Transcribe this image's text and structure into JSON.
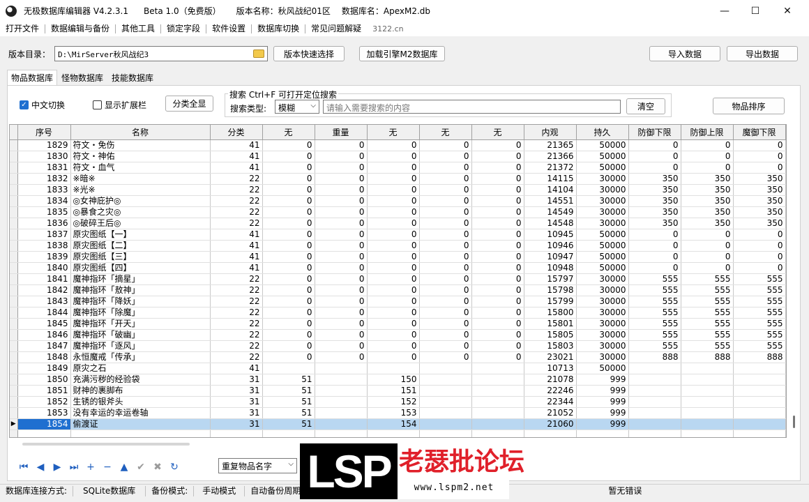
{
  "window": {
    "title_app": "无极数据库编辑器 V4.2.3.1",
    "title_edition": "Beta 1.0（免费版）",
    "title_version": "版本名称：秋风战纪01区",
    "title_db": "数据库名：ApexM2.db",
    "minimize_glyph": "—",
    "maximize_glyph": "☐",
    "close_glyph": "✕"
  },
  "menu": {
    "items": [
      "打开文件",
      "数据编辑与备份",
      "其他工具",
      "锁定字段",
      "软件设置",
      "数据库切换",
      "常见问题解疑"
    ],
    "url": "3122.cn"
  },
  "toolbar": {
    "version_dir_label": "版本目录：",
    "version_dir_value": "D:\\MirServer秋风战纪3",
    "quick_select": "版本快速选择",
    "load_engine": "加载引擎M2数据库",
    "import": "导入数据",
    "export": "导出数据"
  },
  "tabs": [
    "物品数据库",
    "怪物数据库",
    "技能数据库"
  ],
  "options": {
    "chinese_toggle": "中文切换",
    "chinese_toggle_checked": true,
    "show_ext": "显示扩展栏",
    "show_ext_checked": false,
    "show_all": "分类全显",
    "search_title": "搜索   Ctrl+F 可打开定位搜索",
    "search_type_label": "搜索类型:",
    "search_type_value": "模糊",
    "search_placeholder": "请输入需要搜索的内容",
    "clear": "清空",
    "sort": "物品排序"
  },
  "grid": {
    "columns": [
      "序号",
      "名称",
      "分类",
      "无",
      "重量",
      "无",
      "无",
      "无",
      "内观",
      "持久",
      "防御下限",
      "防御上限",
      "魔御下限"
    ],
    "rows": [
      [
        "1829",
        "符文・免伤",
        "41",
        "0",
        "0",
        "0",
        "0",
        "0",
        "21365",
        "50000",
        "0",
        "0",
        "0"
      ],
      [
        "1830",
        "符文・神佑",
        "41",
        "0",
        "0",
        "0",
        "0",
        "0",
        "21366",
        "50000",
        "0",
        "0",
        "0"
      ],
      [
        "1831",
        "符文・血气",
        "41",
        "0",
        "0",
        "0",
        "0",
        "0",
        "21372",
        "50000",
        "0",
        "0",
        "0"
      ],
      [
        "1832",
        "※暗※",
        "22",
        "0",
        "0",
        "0",
        "0",
        "0",
        "14115",
        "30000",
        "350",
        "350",
        "350"
      ],
      [
        "1833",
        "※光※",
        "22",
        "0",
        "0",
        "0",
        "0",
        "0",
        "14104",
        "30000",
        "350",
        "350",
        "350"
      ],
      [
        "1834",
        "◎女神庇护◎",
        "22",
        "0",
        "0",
        "0",
        "0",
        "0",
        "14551",
        "30000",
        "350",
        "350",
        "350"
      ],
      [
        "1835",
        "◎暴食之灾◎",
        "22",
        "0",
        "0",
        "0",
        "0",
        "0",
        "14549",
        "30000",
        "350",
        "350",
        "350"
      ],
      [
        "1836",
        "◎破碎王后◎",
        "22",
        "0",
        "0",
        "0",
        "0",
        "0",
        "14548",
        "30000",
        "350",
        "350",
        "350"
      ],
      [
        "1837",
        "原灾图纸【一】",
        "41",
        "0",
        "0",
        "0",
        "0",
        "0",
        "10945",
        "50000",
        "0",
        "0",
        "0"
      ],
      [
        "1838",
        "原灾图纸【二】",
        "41",
        "0",
        "0",
        "0",
        "0",
        "0",
        "10946",
        "50000",
        "0",
        "0",
        "0"
      ],
      [
        "1839",
        "原灾图纸【三】",
        "41",
        "0",
        "0",
        "0",
        "0",
        "0",
        "10947",
        "50000",
        "0",
        "0",
        "0"
      ],
      [
        "1840",
        "原灾图纸【四】",
        "41",
        "0",
        "0",
        "0",
        "0",
        "0",
        "10948",
        "50000",
        "0",
        "0",
        "0"
      ],
      [
        "1841",
        "魔神指环「摘星」",
        "22",
        "0",
        "0",
        "0",
        "0",
        "0",
        "15797",
        "30000",
        "555",
        "555",
        "555"
      ],
      [
        "1842",
        "魔神指环「敖神」",
        "22",
        "0",
        "0",
        "0",
        "0",
        "0",
        "15798",
        "30000",
        "555",
        "555",
        "555"
      ],
      [
        "1843",
        "魔神指环「降妖」",
        "22",
        "0",
        "0",
        "0",
        "0",
        "0",
        "15799",
        "30000",
        "555",
        "555",
        "555"
      ],
      [
        "1844",
        "魔神指环「除魔」",
        "22",
        "0",
        "0",
        "0",
        "0",
        "0",
        "15800",
        "30000",
        "555",
        "555",
        "555"
      ],
      [
        "1845",
        "魔神指环「开天」",
        "22",
        "0",
        "0",
        "0",
        "0",
        "0",
        "15801",
        "30000",
        "555",
        "555",
        "555"
      ],
      [
        "1846",
        "魔神指环「破幽」",
        "22",
        "0",
        "0",
        "0",
        "0",
        "0",
        "15805",
        "30000",
        "555",
        "555",
        "555"
      ],
      [
        "1847",
        "魔神指环「逐风」",
        "22",
        "0",
        "0",
        "0",
        "0",
        "0",
        "15803",
        "30000",
        "555",
        "555",
        "555"
      ],
      [
        "1848",
        "永恒魔戒「传承」",
        "22",
        "0",
        "0",
        "0",
        "0",
        "0",
        "23021",
        "30000",
        "888",
        "888",
        "888"
      ],
      [
        "1849",
        "原灾之石",
        "41",
        "",
        "",
        "",
        "",
        "",
        "10713",
        "50000",
        "",
        "",
        ""
      ],
      [
        "1850",
        "充满污秽的经验袋",
        "31",
        "51",
        "",
        "150",
        "",
        "",
        "21078",
        "999",
        "",
        "",
        ""
      ],
      [
        "1851",
        "财神的裹脚布",
        "31",
        "51",
        "",
        "151",
        "",
        "",
        "22246",
        "999",
        "",
        "",
        ""
      ],
      [
        "1852",
        "生锈的银斧头",
        "31",
        "51",
        "",
        "152",
        "",
        "",
        "22344",
        "999",
        "",
        "",
        ""
      ],
      [
        "1853",
        "没有幸运的幸运卷轴",
        "31",
        "51",
        "",
        "153",
        "",
        "",
        "21052",
        "999",
        "",
        "",
        ""
      ],
      [
        "1854",
        "偷渡证",
        "31",
        "51",
        "",
        "154",
        "",
        "",
        "21060",
        "999",
        "",
        "",
        ""
      ],
      [
        "",
        "",
        "",
        "",
        "",
        "",
        "",
        "",
        "",
        "",
        "",
        "",
        ""
      ]
    ],
    "selected_row": 25,
    "row_pointer": "▶"
  },
  "navigator": {
    "buttons": [
      {
        "name": "first-record-icon",
        "glyph": "⏮",
        "enabled": true
      },
      {
        "name": "prior-record-icon",
        "glyph": "◀",
        "enabled": true
      },
      {
        "name": "next-record-icon",
        "glyph": "▶",
        "enabled": true
      },
      {
        "name": "last-record-icon",
        "glyph": "⏭",
        "enabled": true
      },
      {
        "name": "insert-record-icon",
        "glyph": "+",
        "enabled": true
      },
      {
        "name": "delete-record-icon",
        "glyph": "−",
        "enabled": true
      },
      {
        "name": "edit-record-icon",
        "glyph": "▲",
        "enabled": true
      },
      {
        "name": "post-record-icon",
        "glyph": "✔",
        "enabled": false
      },
      {
        "name": "cancel-edit-icon",
        "glyph": "✖",
        "enabled": false
      },
      {
        "name": "refresh-icon",
        "glyph": "↻",
        "enabled": true
      }
    ],
    "dup_select_value": "重复物品名字"
  },
  "status": {
    "conn_label": "数据库连接方式:",
    "conn_value": "SQLite数据库",
    "backup_label": "备份模式:",
    "backup_value": "手动模式",
    "auto_backup_label": "自动备份周期:",
    "error_text": "暂无错误"
  },
  "watermark": {
    "logo": "LSP",
    "name": "老瑟批论坛",
    "url": "www.lspm2.net"
  },
  "colors": {
    "accent": "#1f6fd0",
    "selection": "#b9d7f1",
    "watermark_red": "#e0202a"
  }
}
